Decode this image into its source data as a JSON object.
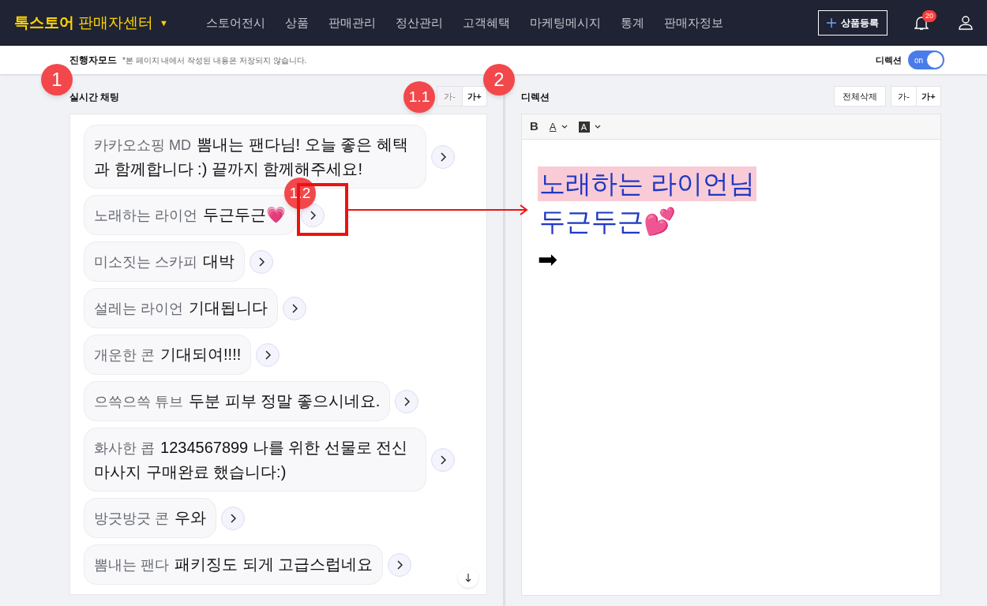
{
  "header": {
    "brand": "톡스토어",
    "brand_sub": "판매자센터",
    "brand_caret": "▼",
    "menu": [
      "스토어전시",
      "상품",
      "판매관리",
      "정산관리",
      "고객혜택",
      "마케팅메시지",
      "통계",
      "판매자정보"
    ],
    "register_button": "상품등록",
    "notification_count": "20"
  },
  "mode_bar": {
    "title": "진행자모드",
    "note": "*본 페이지 내에서 작성된 내용은 저장되지 않습니다.",
    "direction_label": "디렉션",
    "toggle": {
      "label": "on",
      "on": true
    }
  },
  "chat": {
    "title": "실시간 채팅",
    "font_buttons": [
      {
        "label": "가-",
        "disabled": true
      },
      {
        "label": "가+",
        "disabled": false
      }
    ],
    "messages": [
      {
        "sender": "카카오쇼핑 MD",
        "text": "뽐내는 팬다님! 오늘 좋은 혜택과 함께합니다 :) 끝까지 함께해주세요!"
      },
      {
        "sender": "노래하는 라이언",
        "text": "두근두근💗"
      },
      {
        "sender": "미소짓는 스카피",
        "text": "대박"
      },
      {
        "sender": "설레는 라이언",
        "text": "기대됩니다"
      },
      {
        "sender": "개운한 콘",
        "text": "기대되여!!!!"
      },
      {
        "sender": "으쓱으쓱 튜브",
        "text": "두분 피부 정말 좋으시네요."
      },
      {
        "sender": "화사한 콥",
        "text": "1234567899 나를 위한 선물로 전신 마사지 구매완료 했습니다:)"
      },
      {
        "sender": "방긋방긋 콘",
        "text": "우와"
      },
      {
        "sender": "뽐내는 팬다",
        "text": "패키징도 되게 고급스럽네요"
      }
    ]
  },
  "direction": {
    "title": "디렉션",
    "clear_button": "전체삭제",
    "font_buttons": [
      {
        "label": "가-",
        "disabled": false
      },
      {
        "label": "가+",
        "disabled": false
      }
    ],
    "toolbar": [
      {
        "kind": "bold",
        "label": "B"
      },
      {
        "kind": "text-color",
        "label": "A"
      },
      {
        "kind": "highlight",
        "label": "A"
      }
    ],
    "lines": [
      {
        "text": "노래하는 라이언님",
        "highlighted": true
      },
      {
        "text": "두근두근💕",
        "highlighted": false
      },
      {
        "text": "➡",
        "highlighted": false,
        "kind": "symbol"
      }
    ]
  },
  "annotations": [
    "1",
    "1.1",
    "2",
    "1.2"
  ]
}
